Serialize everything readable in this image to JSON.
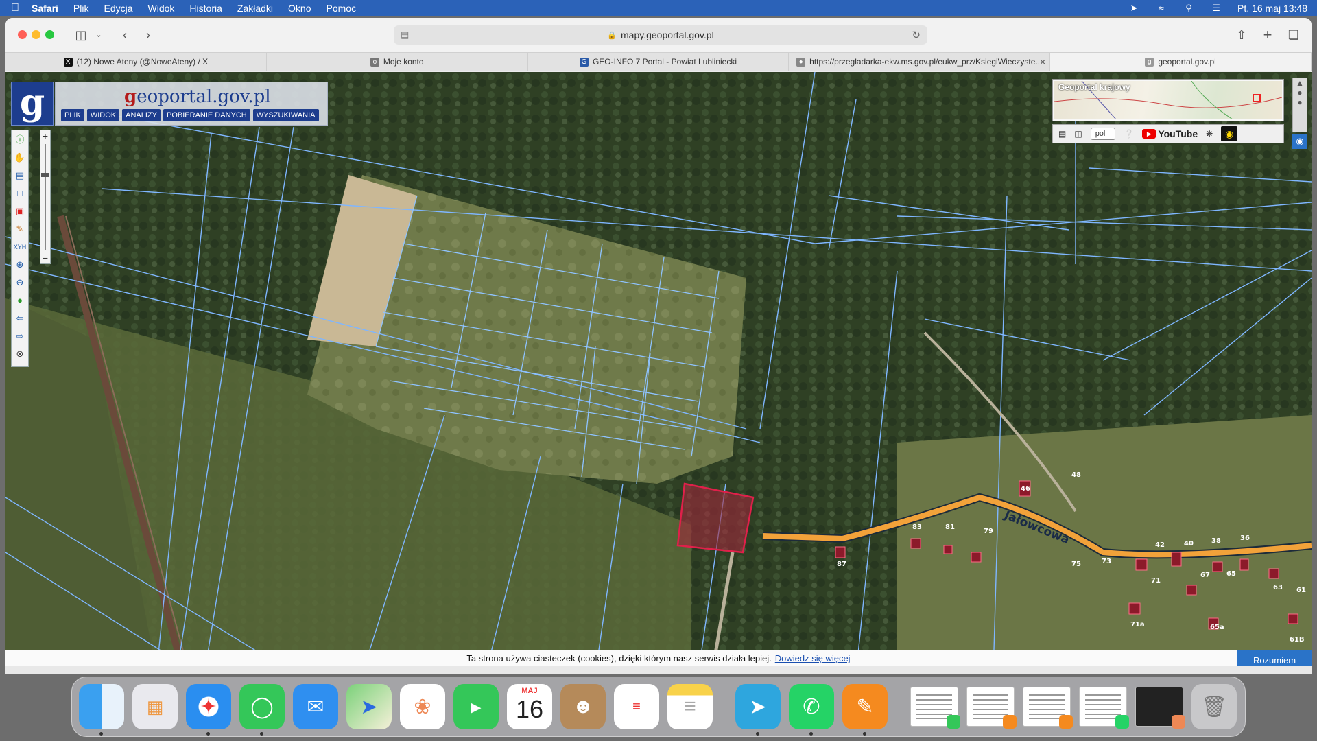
{
  "menubar": {
    "apple_icon": "apple-icon",
    "app_name": "Safari",
    "items": [
      "Plik",
      "Edycja",
      "Widok",
      "Historia",
      "Zakładki",
      "Okno",
      "Pomoc"
    ],
    "clock": "Pt. 16 maj  13:48"
  },
  "browser": {
    "url": "mapy.geoportal.gov.pl",
    "tabs": [
      {
        "label": "(12) Nowe Ateny (@NoweAteny) / X",
        "icon": "x-logo-icon"
      },
      {
        "label": "Moje konto",
        "icon": "account-icon"
      },
      {
        "label": "GEO-INFO 7 Portal - Powiat Lubliniecki",
        "icon": "geoinfo-icon"
      },
      {
        "label": "https://przegladarka-ekw.ms.gov.pl/eukw_prz/KsiegiWieczyste...",
        "icon": "globe-icon"
      },
      {
        "label": "geoportal.gov.pl",
        "icon": "geoportal-icon"
      }
    ]
  },
  "geoportal": {
    "logo_letter": "g",
    "title_prefix": "g",
    "title_rest": "eoportal.gov.pl",
    "menu": [
      "PLIK",
      "WIDOK",
      "ANALIZY",
      "POBIERANIE DANYCH",
      "WYSZUKIWANIA"
    ],
    "overview_title": "Geoportal krajowy",
    "lang": "pol",
    "youtube_label": "YouTube"
  },
  "map": {
    "street_name": "Jałowcowa",
    "house_numbers": [
      "46",
      "48",
      "83",
      "81",
      "79",
      "87",
      "75",
      "73",
      "71",
      "67",
      "65",
      "63",
      "61",
      "61B",
      "71a",
      "65a",
      "38",
      "36",
      "40",
      "42"
    ]
  },
  "cookie": {
    "text": "Ta strona używa ciasteczek (cookies), dzięki którym nasz serwis działa lepiej.",
    "link": "Dowiedz się więcej",
    "button": "Rozumiem"
  },
  "dock": {
    "calendar_month": "MAJ",
    "calendar_day": "16",
    "apps": [
      "finder-icon",
      "launchpad-icon",
      "safari-icon",
      "messages-icon",
      "mail-icon",
      "maps-icon",
      "photos-icon",
      "facetime-icon",
      "calendar-icon",
      "contacts-icon",
      "reminders-icon",
      "notes-icon",
      "telegram-icon",
      "whatsapp-icon",
      "pages-icon"
    ]
  },
  "colors": {
    "menubar": "#2b62b8",
    "geoportal_blue": "#1d3d8e",
    "parcel_line": "#7fb6ff",
    "road": "#f2a23a",
    "highlight": "#e0204a"
  }
}
